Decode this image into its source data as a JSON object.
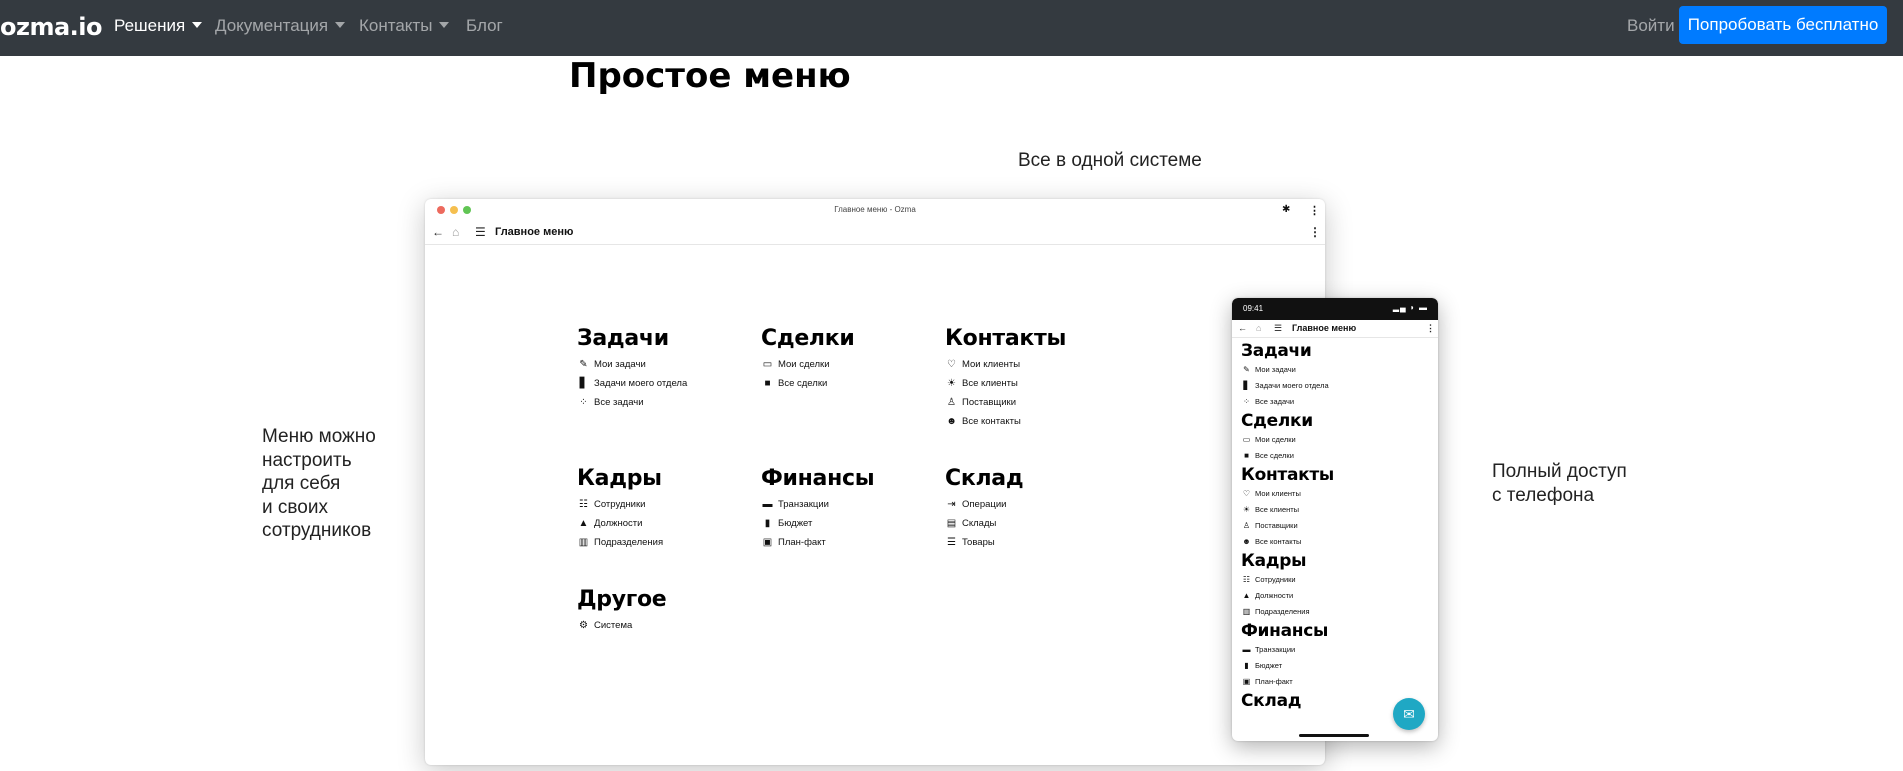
{
  "navbar": {
    "brand": "ozma.io",
    "links": [
      {
        "label": "Решения",
        "active": true,
        "dropdown": true
      },
      {
        "label": "Документация",
        "active": false,
        "dropdown": true
      },
      {
        "label": "Контакты",
        "active": false,
        "dropdown": true
      },
      {
        "label": "Блог",
        "active": false,
        "dropdown": false
      }
    ],
    "login": "Войти",
    "cta": "Попробовать бесплатно"
  },
  "page": {
    "title": "Простое меню",
    "subtitle": "Все в одной системе",
    "left_caption": [
      "Меню можно",
      "настроить",
      "для себя",
      "и своих",
      "сотрудников"
    ],
    "right_caption": [
      "Полный доступ",
      "с телефона"
    ]
  },
  "desktop": {
    "window_title": "Главное меню - Ozma",
    "app_title": "Главное меню",
    "sections": [
      {
        "title": "Задачи",
        "items": [
          {
            "label": "Мои задачи",
            "icon": "pencil-icon"
          },
          {
            "label": "Задачи моего отдела",
            "icon": "door-icon"
          },
          {
            "label": "Все задачи",
            "icon": "dots-grid-icon"
          }
        ]
      },
      {
        "title": "Сделки",
        "items": [
          {
            "label": "Мои сделки",
            "icon": "folder-outline-icon"
          },
          {
            "label": "Все сделки",
            "icon": "folder-icon"
          }
        ]
      },
      {
        "title": "Контакты",
        "items": [
          {
            "label": "Мои клиенты",
            "icon": "heart-icon"
          },
          {
            "label": "Все клиенты",
            "icon": "sparkle-icon"
          },
          {
            "label": "Поставщики",
            "icon": "person-walk-icon"
          },
          {
            "label": "Все контакты",
            "icon": "person-search-icon"
          }
        ]
      },
      {
        "title": "Кадры",
        "items": [
          {
            "label": "Сотрудники",
            "icon": "group-icon"
          },
          {
            "label": "Должности",
            "icon": "graduation-cap-icon"
          },
          {
            "label": "Подразделения",
            "icon": "building-icon"
          }
        ]
      },
      {
        "title": "Финансы",
        "items": [
          {
            "label": "Транзакции",
            "icon": "credit-card-icon"
          },
          {
            "label": "Бюджет",
            "icon": "document-icon"
          },
          {
            "label": "План-факт",
            "icon": "account-box-icon"
          }
        ]
      },
      {
        "title": "Склад",
        "items": [
          {
            "label": "Операции",
            "icon": "input-icon"
          },
          {
            "label": "Склады",
            "icon": "archive-icon"
          },
          {
            "label": "Товары",
            "icon": "list-icon"
          }
        ]
      },
      {
        "title": "Другое",
        "items": [
          {
            "label": "Система",
            "icon": "gear-icon"
          }
        ]
      }
    ]
  },
  "phone": {
    "time": "09:41",
    "app_title": "Главное меню",
    "sections": [
      {
        "title": "Задачи",
        "items": [
          "Мои задачи",
          "Задачи моего отдела",
          "Все задачи"
        ]
      },
      {
        "title": "Сделки",
        "items": [
          "Мои сделки",
          "Все сделки"
        ]
      },
      {
        "title": "Контакты",
        "items": [
          "Мои клиенты",
          "Все клиенты",
          "Поставщики",
          "Все контакты"
        ]
      },
      {
        "title": "Кадры",
        "items": [
          "Сотрудники",
          "Должности",
          "Подразделения"
        ]
      },
      {
        "title": "Финансы",
        "items": [
          "Транзакции",
          "Бюджет",
          "План-факт"
        ]
      },
      {
        "title": "Склад",
        "items": []
      }
    ]
  },
  "colors": {
    "navbar_bg": "#343a40",
    "primary": "#007bff",
    "fab": "#1fa8c4"
  }
}
